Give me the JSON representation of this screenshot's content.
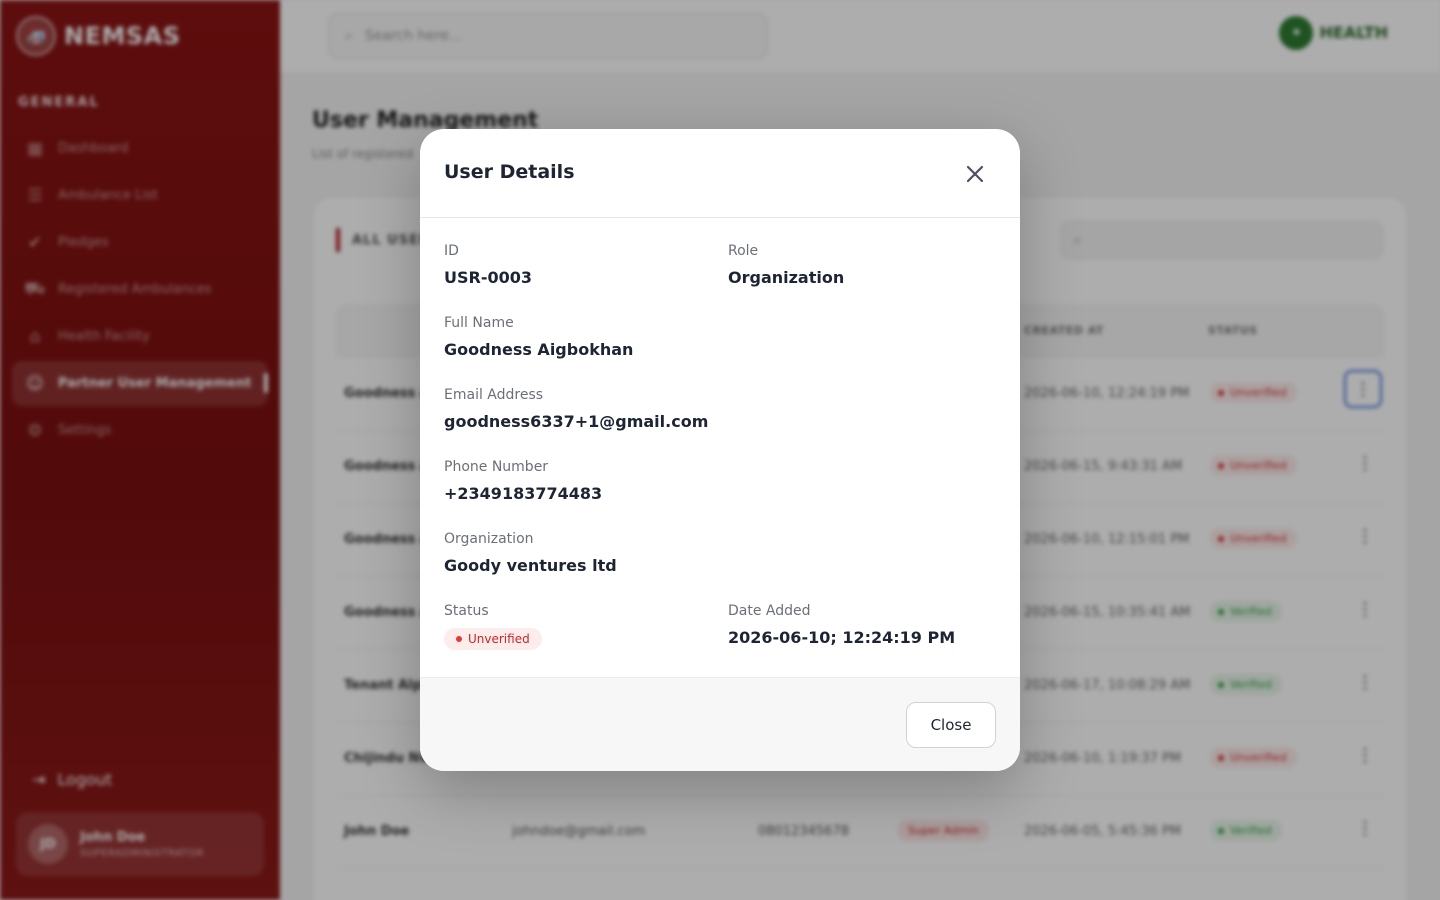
{
  "sidebar": {
    "brand": "NEMSAS",
    "section_title": "GENERAL",
    "items": [
      {
        "label": "Dashboard",
        "icon": "grid-icon"
      },
      {
        "label": "Ambulance List",
        "icon": "list-icon"
      },
      {
        "label": "Pledges",
        "icon": "check-circle-icon"
      },
      {
        "label": "Registered Ambulances",
        "icon": "ambulance-icon"
      },
      {
        "label": "Health Facility",
        "icon": "hospital-icon"
      },
      {
        "label": "Partner User Management",
        "icon": "users-icon"
      },
      {
        "label": "Settings",
        "icon": "gear-icon"
      }
    ],
    "logout": "Logout",
    "user": {
      "initials": "JD",
      "name": "John Doe",
      "role": "SUPERADMINISTRATOR"
    }
  },
  "topbar": {
    "search_placeholder": "Search here...",
    "ministry": "HEALTH"
  },
  "page": {
    "title": "User Management",
    "subtitle": "List of registered",
    "panel_tag": "ALL USER"
  },
  "table": {
    "headers": {
      "created_at": "CREATED AT",
      "status": "STATUS"
    },
    "rows": [
      {
        "name": "Goodness A",
        "created": "2026-06-10, 12:24:19 PM",
        "status": "Unverified"
      },
      {
        "name": "Goodness A",
        "created": "2026-06-15, 9:43:31 AM",
        "status": "Unverified"
      },
      {
        "name": "Goodness A",
        "created": "2026-06-10, 12:15:01 PM",
        "status": "Unverified"
      },
      {
        "name": "Goodness A",
        "created": "2026-06-15, 10:35:41 AM",
        "status": "Verified"
      },
      {
        "name": "Tenant Alph",
        "created": "2026-06-17, 10:08:29 AM",
        "status": "Verified"
      },
      {
        "name": "Chijindu Nw",
        "created": "2026-06-10, 1:19:37 PM",
        "status": "Unverified"
      },
      {
        "name": "John Doe",
        "email": "johndoe@gmail.com",
        "phone": "08012345678",
        "role": "Super Admin",
        "created": "2026-06-05, 5:45:36 PM",
        "status": "Verified"
      }
    ]
  },
  "modal": {
    "title": "User Details",
    "fields": {
      "id": {
        "label": "ID",
        "value": "USR-0003"
      },
      "role": {
        "label": "Role",
        "value": "Organization"
      },
      "full_name": {
        "label": "Full Name",
        "value": "Goodness Aigbokhan"
      },
      "email": {
        "label": "Email Address",
        "value": "goodness6337+1@gmail.com"
      },
      "phone": {
        "label": "Phone Number",
        "value": "+2349183774483"
      },
      "organization": {
        "label": "Organization",
        "value": "Goody ventures ltd"
      },
      "status": {
        "label": "Status",
        "value": "Unverified"
      },
      "date_added": {
        "label": "Date Added",
        "value": "2026-06-10; 12:24:19 PM"
      }
    },
    "close_label": "Close",
    "colors": {
      "unverified": "#c62828",
      "verified": "#2e9d3f",
      "brand": "#8a1414",
      "focus": "#3b6fd8"
    }
  }
}
